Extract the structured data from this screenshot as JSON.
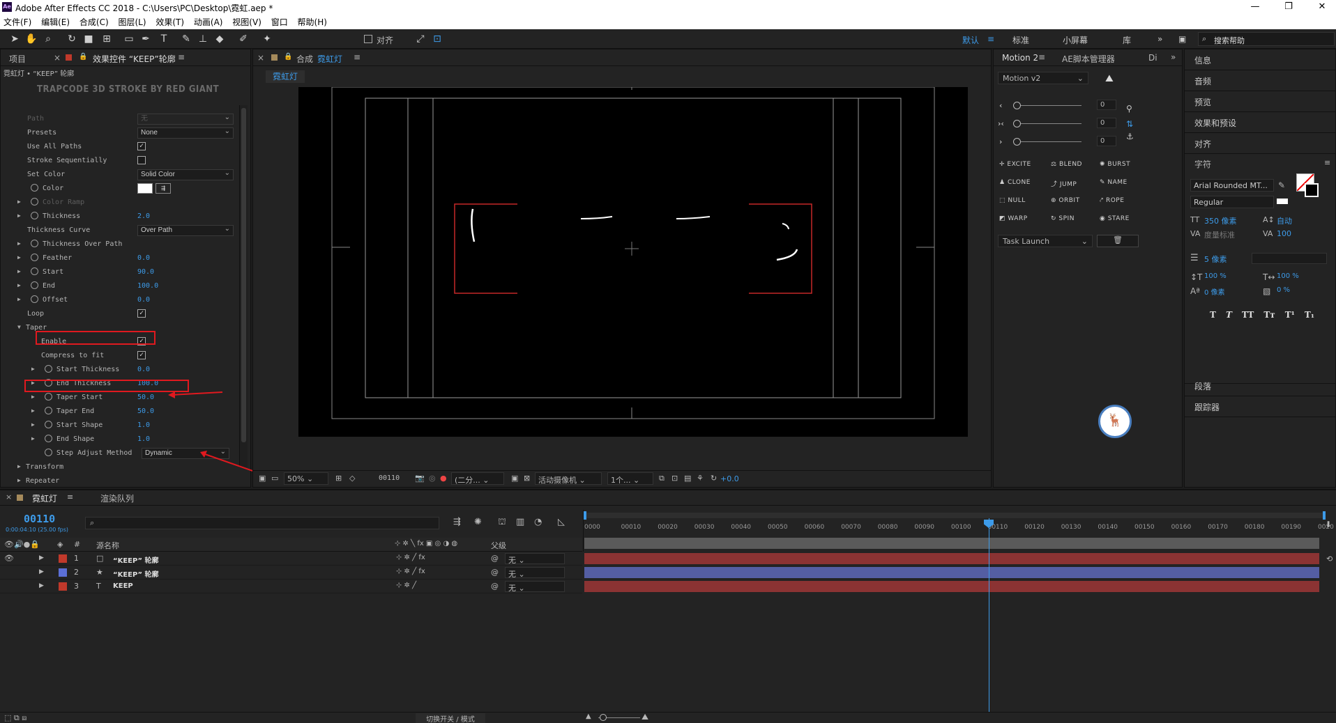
{
  "window": {
    "title": "Adobe After Effects CC 2018 - C:\\Users\\PC\\Desktop\\霓虹.aep *",
    "logo": "Ae",
    "minimize_icon": "—",
    "restore_icon": "❐",
    "close_icon": "✕"
  },
  "menu": [
    "文件(F)",
    "编辑(E)",
    "合成(C)",
    "图层(L)",
    "效果(T)",
    "动画(A)",
    "视图(V)",
    "窗口",
    "帮助(H)"
  ],
  "toolbar": {
    "align_label": "对齐",
    "workspaces": [
      "默认",
      "标准",
      "小屏幕",
      "库"
    ],
    "search_placeholder": "搜索帮助"
  },
  "effects_panel": {
    "tab_project": "项目",
    "tab_effects": "效果控件 “KEEP”轮廓",
    "breadcrumb": "霓虹灯 • “KEEP” 轮廓",
    "plugin_header": "TRAPCODE 3D STROKE BY RED GIANT",
    "rows": [
      {
        "label": "Path",
        "value": "无",
        "kind": "dropdown-dim"
      },
      {
        "label": "Presets",
        "value": "None",
        "kind": "dropdown"
      },
      {
        "label": "Use All Paths",
        "value": "✓",
        "kind": "check"
      },
      {
        "label": "Stroke Sequentially",
        "value": "",
        "kind": "check"
      },
      {
        "label": "Set Color",
        "value": "Solid Color",
        "kind": "dropdown"
      },
      {
        "label": "Color",
        "value": "",
        "kind": "color"
      },
      {
        "label": "Color Ramp",
        "value": "",
        "kind": "dim"
      },
      {
        "label": "Thickness",
        "value": "2.0",
        "kind": "value"
      },
      {
        "label": "Thickness Curve",
        "value": "Over Path",
        "kind": "dropdown"
      },
      {
        "label": "Thickness Over Path",
        "value": "",
        "kind": "group"
      },
      {
        "label": "Feather",
        "value": "0.0",
        "kind": "value"
      },
      {
        "label": "Start",
        "value": "90.0",
        "kind": "value"
      },
      {
        "label": "End",
        "value": "100.0",
        "kind": "value"
      },
      {
        "label": "Offset",
        "value": "0.0",
        "kind": "value"
      },
      {
        "label": "Loop",
        "value": "✓",
        "kind": "check"
      },
      {
        "label": "Taper",
        "value": "",
        "kind": "section"
      },
      {
        "label": "Enable",
        "value": "✓",
        "kind": "check"
      },
      {
        "label": "Compress to fit",
        "value": "✓",
        "kind": "check"
      },
      {
        "label": "Start Thickness",
        "value": "0.0",
        "kind": "value"
      },
      {
        "label": "End Thickness",
        "value": "100.0",
        "kind": "value"
      },
      {
        "label": "Taper Start",
        "value": "50.0",
        "kind": "value"
      },
      {
        "label": "Taper End",
        "value": "50.0",
        "kind": "value"
      },
      {
        "label": "Start Shape",
        "value": "1.0",
        "kind": "value"
      },
      {
        "label": "End Shape",
        "value": "1.0",
        "kind": "value"
      },
      {
        "label": "Step Adjust Method",
        "value": "Dynamic",
        "kind": "dropdown"
      },
      {
        "label": "Transform",
        "value": "",
        "kind": "group-top"
      },
      {
        "label": "Repeater",
        "value": "",
        "kind": "group-top"
      }
    ]
  },
  "comp_panel": {
    "tab_label": "合成",
    "comp_name": "霓虹灯",
    "zoom": "50%",
    "timecode": "00110",
    "resolution": "(二分...",
    "camera": "活动摄像机",
    "views": "1个...",
    "exposure": "+0.0"
  },
  "motion_panel": {
    "tab_motion": "Motion 2",
    "tab_ae": "AE脚本管理器",
    "tab_more": "Di",
    "preset": "Motion v2",
    "slider_values": [
      "0",
      "0",
      "0"
    ],
    "buttons": [
      "EXCITE",
      "BLEND",
      "BURST",
      "CLONE",
      "JUMP",
      "NAME",
      "NULL",
      "ORBIT",
      "ROPE",
      "WARP",
      "SPIN",
      "STARE"
    ],
    "task": "Task Launch"
  },
  "right_panel": {
    "items_top": [
      "信息",
      "音频",
      "预览",
      "效果和预设",
      "对齐"
    ],
    "char_title": "字符",
    "font": "Arial Rounded MT...",
    "style": "Regular",
    "size": "350 像素",
    "leading": "自动",
    "kerning": "度量标准",
    "tracking": "100",
    "stroke": "5 像素",
    "vscale": "100 %",
    "hscale": "100 %",
    "baseline": "0 像素",
    "tsume": "0 %",
    "type_buttons": [
      "T",
      "T",
      "TT",
      "Tт",
      "T¹",
      "T₁"
    ],
    "items_bottom": [
      "段落",
      "跟踪器"
    ]
  },
  "timeline": {
    "tab_comp": "霓虹灯",
    "tab_render": "渲染队列",
    "timecode": "00110",
    "timecode_sub": "0:00:04:10 (25.00 fps)",
    "col_source": "源名称",
    "col_parent": "父级",
    "col_num": "#",
    "layers": [
      {
        "num": "1",
        "name": "“KEEP” 轮廓",
        "color": "#c0392b",
        "parent": "无"
      },
      {
        "num": "2",
        "name": "“KEEP” 轮廓",
        "color": "#5b6fd6",
        "parent": "无"
      },
      {
        "num": "3",
        "name": "KEEP",
        "color": "#c0392b",
        "parent": "无"
      }
    ],
    "ruler": [
      "0000",
      "00010",
      "00020",
      "00030",
      "00040",
      "00050",
      "00060",
      "00070",
      "00080",
      "00090",
      "00100",
      "00110",
      "00120",
      "00130",
      "00140",
      "00150",
      "00160",
      "00170",
      "00180",
      "00190",
      "0020"
    ],
    "bar_colors": [
      "#8b3333",
      "#545ea3",
      "#8b3333"
    ],
    "toggle_label": "切换开关 / 模式"
  }
}
